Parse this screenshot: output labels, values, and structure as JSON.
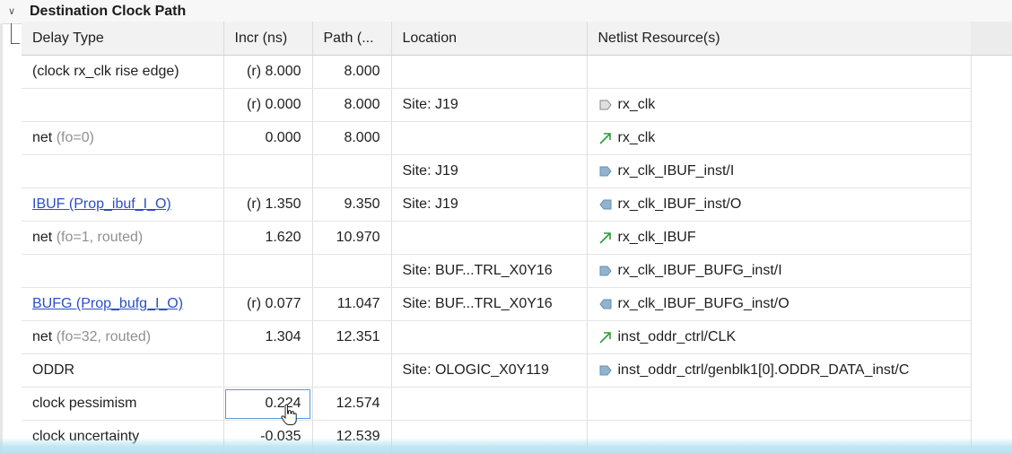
{
  "section": {
    "title": "Destination Clock Path"
  },
  "columns": [
    "Delay Type",
    "Incr (ns)",
    "Path (...",
    "Location",
    "Netlist Resource(s)"
  ],
  "rows": [
    {
      "delay_type": "(clock rx_clk rise edge)",
      "delay_note": "",
      "incr": "(r) 8.000",
      "path": "8.000",
      "location": "",
      "resource": "",
      "resource_icon": "",
      "style": "plain"
    },
    {
      "delay_type": "",
      "delay_note": "",
      "incr": "(r) 0.000",
      "path": "8.000",
      "location": "Site: J19",
      "resource": "rx_clk",
      "resource_icon": "port-icon",
      "style": "plain"
    },
    {
      "delay_type": "net",
      "delay_note": "(fo=0)",
      "incr": "0.000",
      "path": "8.000",
      "location": "",
      "resource": "rx_clk",
      "resource_icon": "net-arrow-icon",
      "style": "net"
    },
    {
      "delay_type": "",
      "delay_note": "",
      "incr": "",
      "path": "",
      "location": "Site: J19",
      "resource": "rx_clk_IBUF_inst/I",
      "resource_icon": "pin-in-icon",
      "style": "plain"
    },
    {
      "delay_type": "IBUF (Prop_ibuf_I_O)",
      "delay_note": "",
      "incr": "(r) 1.350",
      "path": "9.350",
      "location": "Site: J19",
      "resource": "rx_clk_IBUF_inst/O",
      "resource_icon": "pin-out-icon",
      "style": "link"
    },
    {
      "delay_type": "net",
      "delay_note": "(fo=1, routed)",
      "incr": "1.620",
      "path": "10.970",
      "location": "",
      "resource": "rx_clk_IBUF",
      "resource_icon": "net-arrow-icon",
      "style": "net"
    },
    {
      "delay_type": "",
      "delay_note": "",
      "incr": "",
      "path": "",
      "location": "Site: BUF...TRL_X0Y16",
      "resource": "rx_clk_IBUF_BUFG_inst/I",
      "resource_icon": "pin-in-icon",
      "style": "plain"
    },
    {
      "delay_type": "BUFG (Prop_bufg_I_O)",
      "delay_note": "",
      "incr": "(r) 0.077",
      "path": "11.047",
      "location": "Site: BUF...TRL_X0Y16",
      "resource": "rx_clk_IBUF_BUFG_inst/O",
      "resource_icon": "pin-out-icon",
      "style": "link"
    },
    {
      "delay_type": "net",
      "delay_note": "(fo=32, routed)",
      "incr": "1.304",
      "path": "12.351",
      "location": "",
      "resource": "inst_oddr_ctrl/CLK",
      "resource_icon": "net-arrow-icon",
      "style": "net"
    },
    {
      "delay_type": "ODDR",
      "delay_note": "",
      "incr": "",
      "path": "",
      "location": "Site: OLOGIC_X0Y119",
      "resource": "inst_oddr_ctrl/genblk1[0].ODDR_DATA_inst/C",
      "resource_icon": "pin-in-icon",
      "style": "plain"
    },
    {
      "delay_type": "clock pessimism",
      "delay_note": "",
      "incr": "0.224",
      "path": "12.574",
      "location": "",
      "resource": "",
      "resource_icon": "",
      "style": "plain",
      "editing": true
    },
    {
      "delay_type": "clock uncertainty",
      "delay_note": "",
      "incr": "-0.035",
      "path": "12.539",
      "location": "",
      "resource": "",
      "resource_icon": "",
      "style": "plain"
    }
  ],
  "colors": {
    "link": "#2a4fc7",
    "muted": "#909090",
    "net_arrow": "#2e9b3a",
    "pin_icon": "#8fb3d1",
    "selection": "#5b9bd5"
  }
}
